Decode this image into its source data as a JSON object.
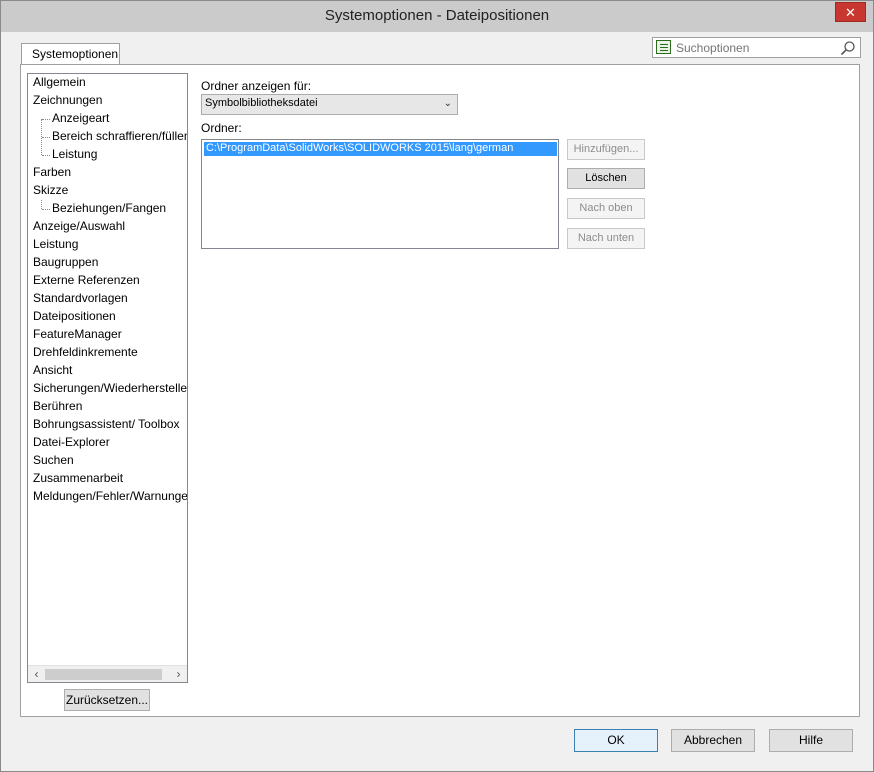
{
  "window": {
    "title": "Systemoptionen - Dateipositionen",
    "close_label": "✕"
  },
  "tab": {
    "label": "Systemoptionen"
  },
  "search": {
    "placeholder": "Suchoptionen"
  },
  "tree": {
    "items": [
      {
        "label": "Allgemein",
        "level": 0
      },
      {
        "label": "Zeichnungen",
        "level": 0
      },
      {
        "label": "Anzeigeart",
        "level": 1
      },
      {
        "label": "Bereich schraffieren/füllen",
        "level": 1
      },
      {
        "label": "Leistung",
        "level": 1
      },
      {
        "label": "Farben",
        "level": 0
      },
      {
        "label": "Skizze",
        "level": 0
      },
      {
        "label": "Beziehungen/Fangen",
        "level": 1
      },
      {
        "label": "Anzeige/Auswahl",
        "level": 0
      },
      {
        "label": "Leistung",
        "level": 0
      },
      {
        "label": "Baugruppen",
        "level": 0
      },
      {
        "label": "Externe Referenzen",
        "level": 0
      },
      {
        "label": "Standardvorlagen",
        "level": 0
      },
      {
        "label": "Dateipositionen",
        "level": 0,
        "selected": true
      },
      {
        "label": "FeatureManager",
        "level": 0
      },
      {
        "label": "Drehfeldinkremente",
        "level": 0
      },
      {
        "label": "Ansicht",
        "level": 0
      },
      {
        "label": "Sicherungen/Wiederherstellen",
        "level": 0
      },
      {
        "label": "Berühren",
        "level": 0
      },
      {
        "label": "Bohrungsassistent/ Toolbox",
        "level": 0
      },
      {
        "label": "Datei-Explorer",
        "level": 0
      },
      {
        "label": "Suchen",
        "level": 0
      },
      {
        "label": "Zusammenarbeit",
        "level": 0
      },
      {
        "label": "Meldungen/Fehler/Warnungen",
        "level": 0
      }
    ],
    "scroll_left": "‹",
    "scroll_right": "›"
  },
  "reset_button": "Zurücksetzen...",
  "folder_type": {
    "label": "Ordner anzeigen für:",
    "selected": "Symbolbibliotheksdatei"
  },
  "folders": {
    "label": "Ordner:",
    "items": [
      "C:\\ProgramData\\SolidWorks\\SOLIDWORKS 2015\\lang\\german"
    ]
  },
  "side_buttons": {
    "add": "Hinzufügen...",
    "delete": "Löschen",
    "up": "Nach oben",
    "down": "Nach unten"
  },
  "footer": {
    "ok": "OK",
    "cancel": "Abbrechen",
    "help": "Hilfe"
  }
}
